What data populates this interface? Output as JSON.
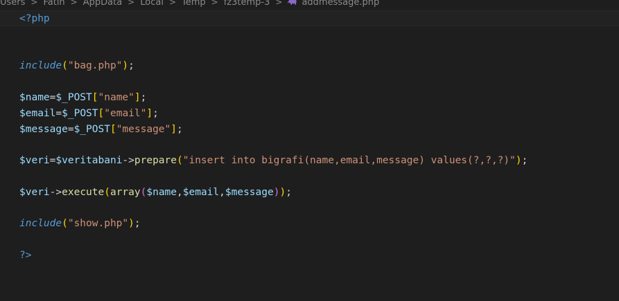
{
  "breadcrumb": {
    "items": [
      "Users",
      "Fatih",
      "AppData",
      "Local",
      "Temp",
      "fz3temp-3",
      "addmessage.php"
    ],
    "separator": ">",
    "file_icon": "php-elephant-icon"
  },
  "colors": {
    "background": "#1e1e1e",
    "keyword": "#569cd6",
    "variable": "#9cdcfe",
    "string": "#ce9178",
    "function": "#dcdcaa",
    "bracket_level1": "#ffd700",
    "bracket_level2": "#da70d6"
  },
  "code": {
    "language": "php",
    "lines": [
      [
        {
          "t": "<?php",
          "k": "tag"
        }
      ],
      [],
      [],
      [
        {
          "t": "include",
          "k": "kw"
        },
        {
          "t": "(",
          "k": "br1"
        },
        {
          "t": "\"bag.php\"",
          "k": "str"
        },
        {
          "t": ")",
          "k": "br1"
        },
        {
          "t": ";",
          "k": "op"
        }
      ],
      [],
      [
        {
          "t": "$name",
          "k": "var"
        },
        {
          "t": "=",
          "k": "op"
        },
        {
          "t": "$_POST",
          "k": "var"
        },
        {
          "t": "[",
          "k": "br1"
        },
        {
          "t": "\"name\"",
          "k": "str"
        },
        {
          "t": "]",
          "k": "br1"
        },
        {
          "t": ";",
          "k": "op"
        }
      ],
      [
        {
          "t": "$email",
          "k": "var"
        },
        {
          "t": "=",
          "k": "op"
        },
        {
          "t": "$_POST",
          "k": "var"
        },
        {
          "t": "[",
          "k": "br1"
        },
        {
          "t": "\"email\"",
          "k": "str"
        },
        {
          "t": "]",
          "k": "br1"
        },
        {
          "t": ";",
          "k": "op"
        }
      ],
      [
        {
          "t": "$message",
          "k": "var"
        },
        {
          "t": "=",
          "k": "op"
        },
        {
          "t": "$_POST",
          "k": "var"
        },
        {
          "t": "[",
          "k": "br1"
        },
        {
          "t": "\"message\"",
          "k": "str"
        },
        {
          "t": "]",
          "k": "br1"
        },
        {
          "t": ";",
          "k": "op"
        }
      ],
      [],
      [
        {
          "t": "$veri",
          "k": "var"
        },
        {
          "t": "=",
          "k": "op"
        },
        {
          "t": "$veritabani",
          "k": "var"
        },
        {
          "t": "->",
          "k": "op"
        },
        {
          "t": "prepare",
          "k": "fn"
        },
        {
          "t": "(",
          "k": "br1"
        },
        {
          "t": "\"insert into bigrafi(name,email,message) values(?,?,?)\"",
          "k": "str"
        },
        {
          "t": ")",
          "k": "br1"
        },
        {
          "t": ";",
          "k": "op"
        }
      ],
      [],
      [
        {
          "t": "$veri",
          "k": "var"
        },
        {
          "t": "->",
          "k": "op"
        },
        {
          "t": "execute",
          "k": "fn"
        },
        {
          "t": "(",
          "k": "br1"
        },
        {
          "t": "array",
          "k": "fn"
        },
        {
          "t": "(",
          "k": "br2"
        },
        {
          "t": "$name",
          "k": "var"
        },
        {
          "t": ",",
          "k": "op"
        },
        {
          "t": "$email",
          "k": "var"
        },
        {
          "t": ",",
          "k": "op"
        },
        {
          "t": "$message",
          "k": "var"
        },
        {
          "t": ")",
          "k": "br2"
        },
        {
          "t": ")",
          "k": "br1"
        },
        {
          "t": ";",
          "k": "op"
        }
      ],
      [],
      [
        {
          "t": "include",
          "k": "kw"
        },
        {
          "t": "(",
          "k": "br1"
        },
        {
          "t": "\"show.php\"",
          "k": "str"
        },
        {
          "t": ")",
          "k": "br1"
        },
        {
          "t": ";",
          "k": "op"
        }
      ],
      [],
      [
        {
          "t": "?>",
          "k": "tag"
        }
      ]
    ]
  }
}
